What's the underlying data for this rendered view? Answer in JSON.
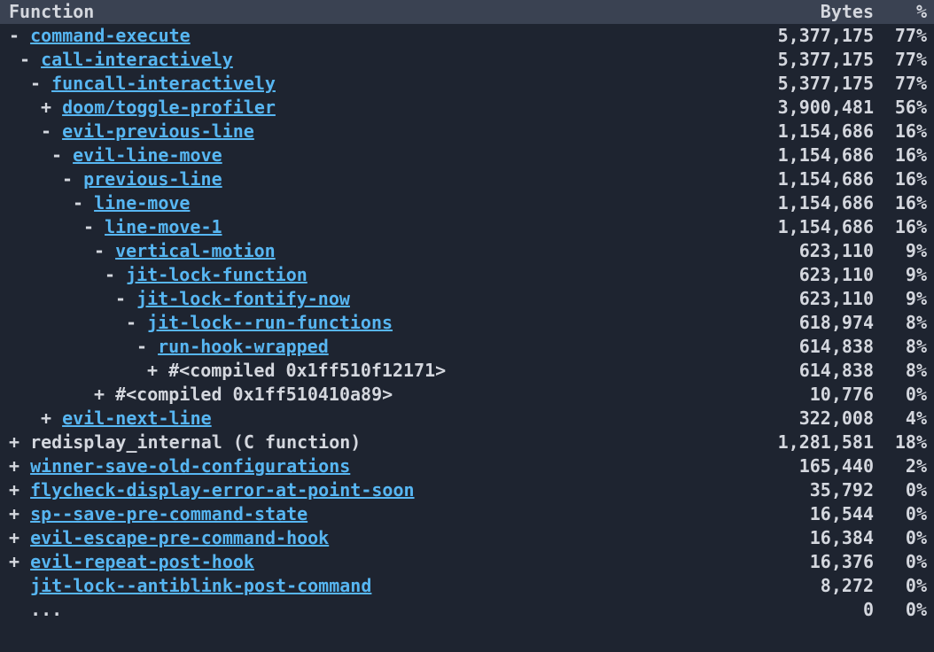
{
  "colors": {
    "background": "#1e2430",
    "foreground": "#d4d7de",
    "link": "#57b6f2",
    "header_bg": "#3a4252"
  },
  "columns": {
    "function": "Function",
    "bytes": "Bytes",
    "percent": "%"
  },
  "rows": [
    {
      "indent": 0,
      "toggle": "-",
      "name": "command-execute",
      "link": true,
      "bytes": "5,377,175",
      "pct": "77%"
    },
    {
      "indent": 1,
      "toggle": "-",
      "name": "call-interactively",
      "link": true,
      "bytes": "5,377,175",
      "pct": "77%"
    },
    {
      "indent": 2,
      "toggle": "-",
      "name": "funcall-interactively",
      "link": true,
      "bytes": "5,377,175",
      "pct": "77%"
    },
    {
      "indent": 3,
      "toggle": "+",
      "name": "doom/toggle-profiler",
      "link": true,
      "bytes": "3,900,481",
      "pct": "56%"
    },
    {
      "indent": 3,
      "toggle": "-",
      "name": "evil-previous-line",
      "link": true,
      "bytes": "1,154,686",
      "pct": "16%"
    },
    {
      "indent": 4,
      "toggle": "-",
      "name": "evil-line-move",
      "link": true,
      "bytes": "1,154,686",
      "pct": "16%"
    },
    {
      "indent": 5,
      "toggle": "-",
      "name": "previous-line",
      "link": true,
      "bytes": "1,154,686",
      "pct": "16%"
    },
    {
      "indent": 6,
      "toggle": "-",
      "name": "line-move",
      "link": true,
      "bytes": "1,154,686",
      "pct": "16%"
    },
    {
      "indent": 7,
      "toggle": "-",
      "name": "line-move-1",
      "link": true,
      "bytes": "1,154,686",
      "pct": "16%"
    },
    {
      "indent": 8,
      "toggle": "-",
      "name": "vertical-motion",
      "link": true,
      "bytes": "623,110",
      "pct": "9%"
    },
    {
      "indent": 9,
      "toggle": "-",
      "name": "jit-lock-function",
      "link": true,
      "bytes": "623,110",
      "pct": "9%"
    },
    {
      "indent": 10,
      "toggle": "-",
      "name": "jit-lock-fontify-now",
      "link": true,
      "bytes": "623,110",
      "pct": "9%"
    },
    {
      "indent": 11,
      "toggle": "-",
      "name": "jit-lock--run-functions",
      "link": true,
      "bytes": "618,974",
      "pct": "8%"
    },
    {
      "indent": 12,
      "toggle": "-",
      "name": "run-hook-wrapped",
      "link": true,
      "bytes": "614,838",
      "pct": "8%"
    },
    {
      "indent": 13,
      "toggle": "+",
      "name": "#<compiled 0x1ff510f12171>",
      "link": false,
      "bytes": "614,838",
      "pct": "8%"
    },
    {
      "indent": 8,
      "toggle": "+",
      "name": "#<compiled 0x1ff510410a89>",
      "link": false,
      "bytes": "10,776",
      "pct": "0%"
    },
    {
      "indent": 3,
      "toggle": "+",
      "name": "evil-next-line",
      "link": true,
      "bytes": "322,008",
      "pct": "4%"
    },
    {
      "indent": 0,
      "toggle": "+",
      "name": "redisplay_internal (C function)",
      "link": false,
      "bytes": "1,281,581",
      "pct": "18%"
    },
    {
      "indent": 0,
      "toggle": "+",
      "name": "winner-save-old-configurations",
      "link": true,
      "bytes": "165,440",
      "pct": "2%"
    },
    {
      "indent": 0,
      "toggle": "+",
      "name": "flycheck-display-error-at-point-soon",
      "link": true,
      "bytes": "35,792",
      "pct": "0%"
    },
    {
      "indent": 0,
      "toggle": "+",
      "name": "sp--save-pre-command-state",
      "link": true,
      "bytes": "16,544",
      "pct": "0%"
    },
    {
      "indent": 0,
      "toggle": "+",
      "name": "evil-escape-pre-command-hook",
      "link": true,
      "bytes": "16,384",
      "pct": "0%"
    },
    {
      "indent": 0,
      "toggle": "+",
      "name": "evil-repeat-post-hook",
      "link": true,
      "bytes": "16,376",
      "pct": "0%"
    },
    {
      "indent": 0,
      "toggle": "",
      "name": "jit-lock--antiblink-post-command",
      "link": true,
      "bytes": "8,272",
      "pct": "0%"
    },
    {
      "indent": 0,
      "toggle": "",
      "name": "...",
      "link": false,
      "bytes": "0",
      "pct": "0%"
    }
  ]
}
